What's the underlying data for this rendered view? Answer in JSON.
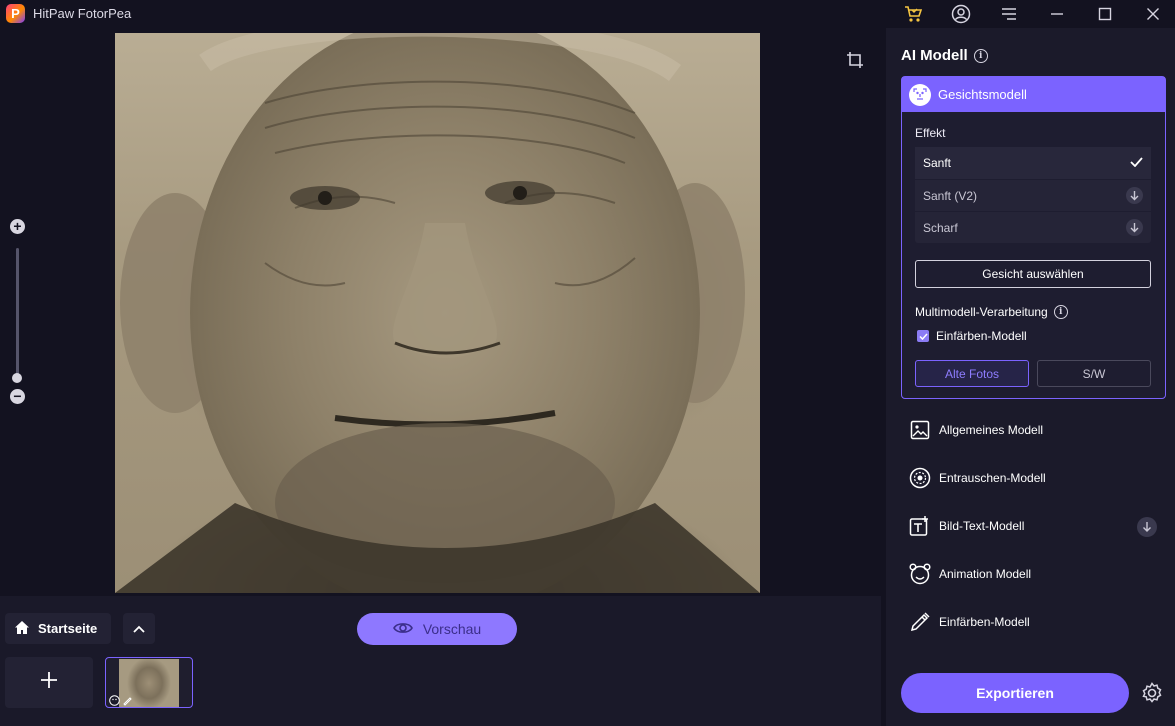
{
  "app": {
    "title": "HitPaw FotorPea",
    "logo_letter": "P"
  },
  "titlebar_icons": [
    "cart-icon",
    "account-icon",
    "menu-icon",
    "minimize-icon",
    "maximize-icon",
    "close-icon"
  ],
  "bottom": {
    "home_label": "Startseite",
    "preview_label": "Vorschau"
  },
  "panel": {
    "title": "AI Modell",
    "active_model": {
      "label": "Gesichtsmodell",
      "effekt_label": "Effekt",
      "effects": [
        {
          "label": "Sanft",
          "state": "selected"
        },
        {
          "label": "Sanft (V2)",
          "state": "download"
        },
        {
          "label": "Scharf",
          "state": "download"
        }
      ],
      "select_face_label": "Gesicht auswählen",
      "multi_label": "Multimodell-Verarbeitung",
      "checkbox_label": "Einfärben-Modell",
      "checkbox_checked": true,
      "option_a": "Alte Fotos",
      "option_b": "S/W"
    },
    "models": [
      {
        "label": "Allgemeines Modell",
        "icon": "image-icon"
      },
      {
        "label": "Entrauschen-Modell",
        "icon": "denoise-icon"
      },
      {
        "label": "Bild-Text-Modell",
        "icon": "text-image-icon"
      },
      {
        "label": "Animation Modell",
        "icon": "animation-icon"
      },
      {
        "label": "Einfärben-Modell",
        "icon": "colorize-icon"
      }
    ],
    "export_label": "Exportieren"
  },
  "colors": {
    "accent": "#7b63ff",
    "preview": "#8e78ff",
    "background": "#131220",
    "panel": "#1b1a2a"
  }
}
